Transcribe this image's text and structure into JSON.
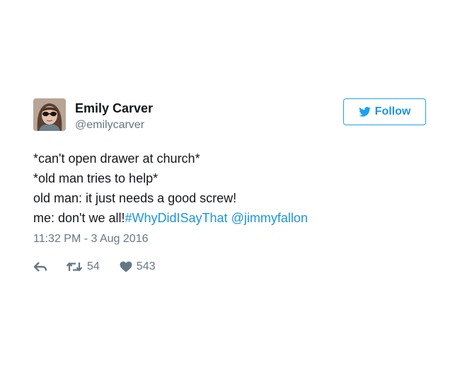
{
  "user": {
    "name": "Emily Carver",
    "handle": "@emilycarver"
  },
  "follow_button": {
    "label": "Follow",
    "icon": "twitter-bird-icon",
    "accent_color": "#1da1f2"
  },
  "tweet": {
    "lines": [
      "*can't open drawer at church*",
      "*old man tries to help*",
      "old man: it just needs a good screw!"
    ],
    "last_line_text": "me: don't we all!",
    "hashtag": "#WhyDidISayThat",
    "mention": "@jimmyfallon",
    "timestamp": "11:32 PM - 3 Aug 2016"
  },
  "actions": {
    "reply_icon": "reply-icon",
    "retweet_icon": "retweet-icon",
    "retweet_count": "54",
    "like_icon": "heart-icon",
    "like_count": "543"
  }
}
